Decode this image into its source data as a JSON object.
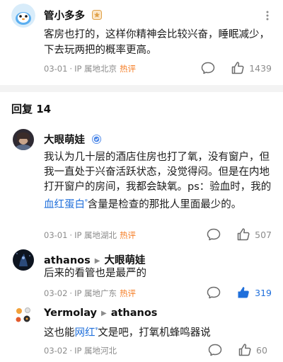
{
  "top_comment": {
    "username": "管小多多",
    "text": "客房也打的，这样你精神会比较兴奋，睡眠减少，下去玩两把的概率更高。",
    "date": "03-01",
    "location": "IP 属地北京",
    "tag": "热评",
    "likes": "1439"
  },
  "replies_header": "回复 14",
  "replies": [
    {
      "username": "大眼萌娃",
      "text_part1": "我认为几十层的酒店住房也打了氧，没有窗户，但我一直处于兴奋活跃状态，没觉得闷。但是在内地打开窗户的房间，我都会缺氧。ps：验血时，我的",
      "link_text": "血红蛋白",
      "text_part2": "含量是检查的那批人里面最少的。",
      "date": "03-01",
      "location": "IP 属地湖北",
      "tag": "热评",
      "likes": "507"
    },
    {
      "username": "athanos",
      "reply_to": "大眼萌娃",
      "text": "后来的看管也是最严的",
      "date": "03-02",
      "location": "IP 属地广东",
      "tag": "热评",
      "likes": "319"
    },
    {
      "username": "Yermolay",
      "reply_to": "athanos",
      "text_part1": "这也能",
      "link_text": "网红",
      "text_part2": "文是吧，打氧机蜂鸣器说",
      "date": "03-02",
      "location": "IP 属地河北",
      "likes": "60"
    }
  ],
  "colors": {
    "hot_tag": "#f57e26",
    "link": "#1f6fdb",
    "liked": "#1f6fdb",
    "meta": "#8c8c8c"
  },
  "icons": [
    "badge-icon",
    "more-icon",
    "comment-icon",
    "thumbs-up-icon",
    "verified-icon",
    "search-mark-icon",
    "reply-arrow-icon"
  ]
}
